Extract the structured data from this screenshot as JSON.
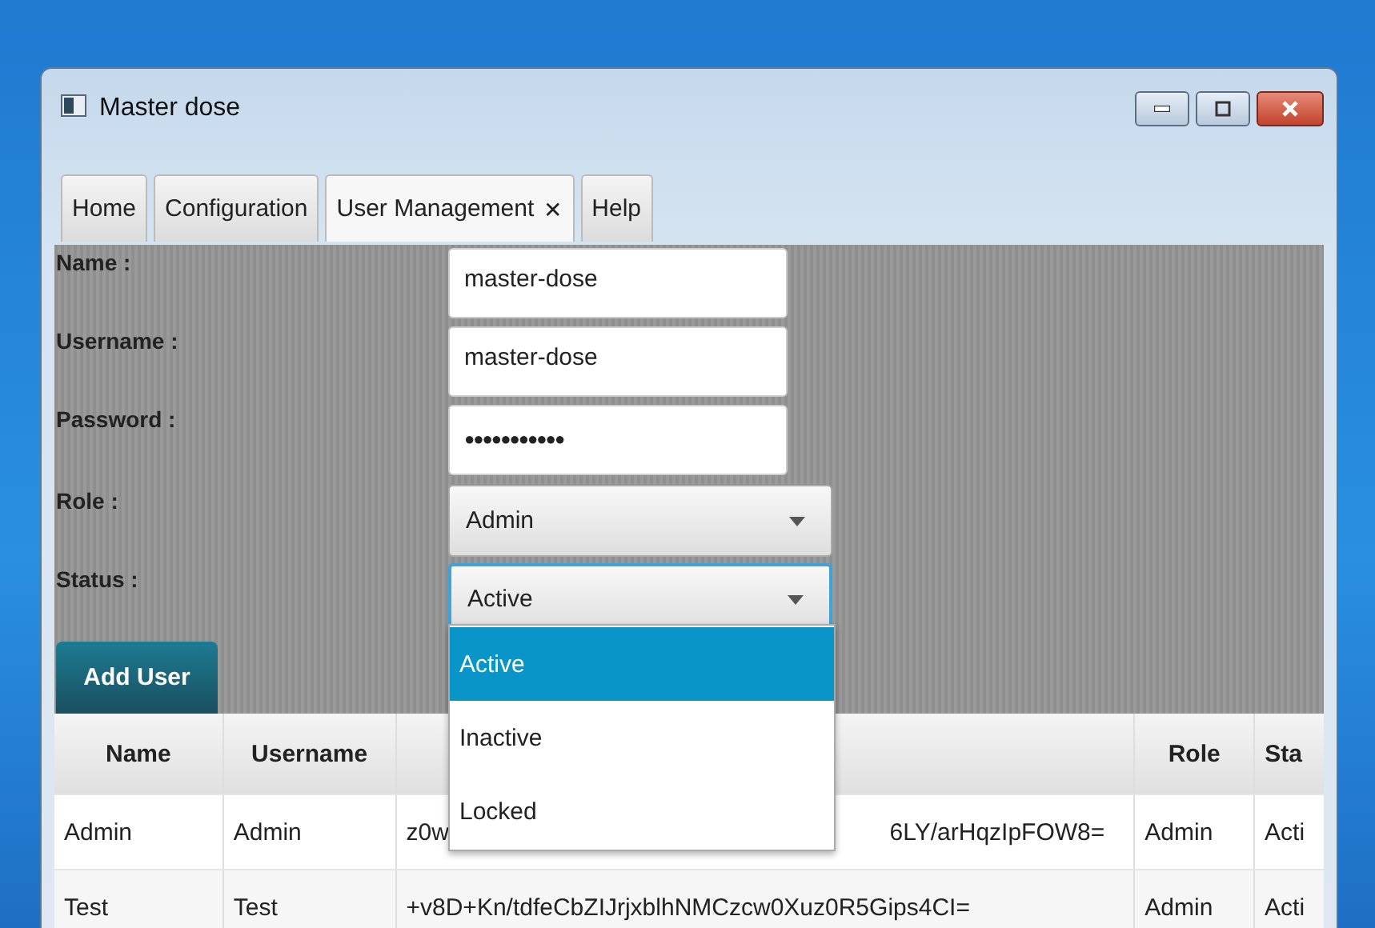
{
  "window": {
    "title": "Master dose"
  },
  "tabs": [
    {
      "label": "Home",
      "selected": false
    },
    {
      "label": "Configuration",
      "selected": false
    },
    {
      "label": "User Management",
      "selected": true,
      "close": "✕"
    },
    {
      "label": "Help",
      "selected": false
    }
  ],
  "form": {
    "fields": [
      {
        "kind": "text",
        "label": "Name :",
        "value": "master-dose"
      },
      {
        "kind": "text",
        "label": "Username :",
        "value": "master-dose"
      },
      {
        "kind": "password",
        "label": "Password :",
        "value": "●●●●●●●●●●●"
      },
      {
        "kind": "combo",
        "label": "Role :",
        "value": "Admin",
        "focused": false
      },
      {
        "kind": "combo",
        "label": "Status :",
        "value": "Active",
        "focused": true
      }
    ],
    "button": "Add User"
  },
  "dropdown": {
    "options": [
      {
        "label": "Active",
        "selected": true
      },
      {
        "label": "Inactive",
        "selected": false
      },
      {
        "label": "Locked",
        "selected": false
      }
    ]
  },
  "table": {
    "columns": [
      "Name",
      "Username",
      "",
      "Role",
      "Sta"
    ],
    "rows": [
      [
        "Admin",
        "Admin",
        [
          "z0w",
          "6LY/arHqzIpFOW8="
        ],
        "Admin",
        "Acti"
      ],
      [
        "Test",
        "Test",
        [
          "+v8D+Kn/tdfeCbZIJrjxblhNMCzcw0Xuz0R5Gips4CI="
        ],
        "Admin",
        "Acti"
      ]
    ]
  }
}
